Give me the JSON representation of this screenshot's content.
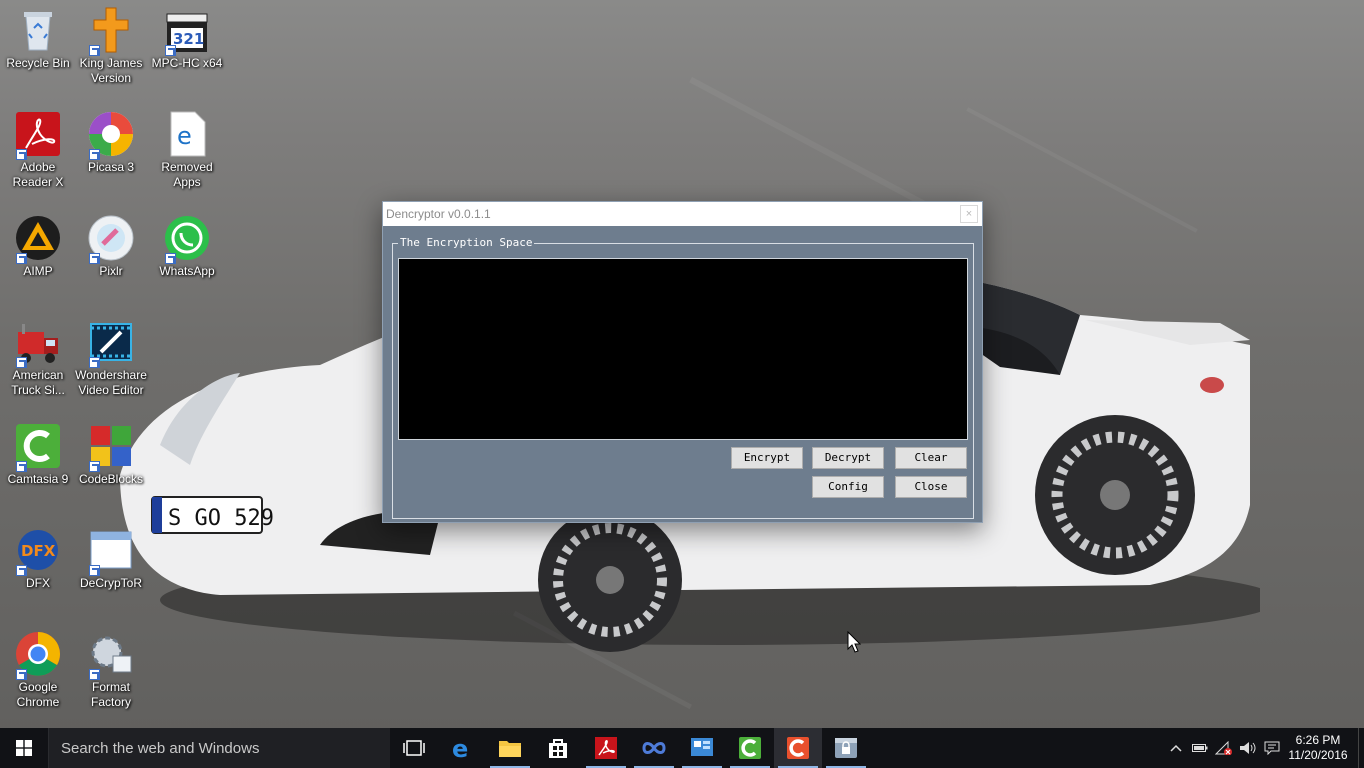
{
  "desktop": {
    "icons": [
      {
        "label": "Recycle Bin",
        "icon": "recycle-bin-icon"
      },
      {
        "label": "King James Version",
        "icon": "cross-icon"
      },
      {
        "label": "MPC-HC x64",
        "icon": "mpc-clapper-icon"
      },
      {
        "label": "Adobe Reader X",
        "icon": "adobe-reader-icon"
      },
      {
        "label": "Picasa 3",
        "icon": "picasa-icon"
      },
      {
        "label": "Removed Apps",
        "icon": "edge-document-icon"
      },
      {
        "label": "AIMP",
        "icon": "aimp-icon"
      },
      {
        "label": "Pixlr",
        "icon": "pixlr-icon"
      },
      {
        "label": "WhatsApp",
        "icon": "whatsapp-icon"
      },
      {
        "label": "American Truck Si...",
        "icon": "truck-icon"
      },
      {
        "label": "Wondershare Video Editor",
        "icon": "video-editor-icon"
      },
      {
        "label": "Camtasia 9",
        "icon": "camtasia-icon"
      },
      {
        "label": "CodeBlocks",
        "icon": "codeblocks-icon"
      },
      {
        "label": "DFX",
        "icon": "dfx-icon"
      },
      {
        "label": "DeCrypToR",
        "icon": "window-app-icon"
      },
      {
        "label": "Google Chrome",
        "icon": "chrome-icon"
      },
      {
        "label": "Format Factory",
        "icon": "format-factory-icon"
      }
    ]
  },
  "wallpaper": {
    "license_plate": "S GO 529"
  },
  "window": {
    "title": "Dencryptor v0.0.1.1",
    "close_glyph": "×",
    "group_label": "The Encryption Space",
    "textarea_value": "",
    "buttons": {
      "encrypt": "Encrypt",
      "decrypt": "Decrypt",
      "clear": "Clear",
      "config": "Config",
      "close": "Close"
    }
  },
  "taskbar": {
    "search_placeholder": "Search the web and Windows",
    "pinned": [
      "task-view-icon",
      "edge-icon",
      "file-explorer-icon",
      "store-icon",
      "adobe-reader-icon",
      "infinity-app-icon",
      "control-panel-icon",
      "camtasia-icon",
      "camtasia-recorder-icon",
      "dencryptor-icon"
    ],
    "clock_time": "6:26 PM",
    "clock_date": "11/20/2016"
  },
  "colors": {
    "window_body": "#6e7d8e",
    "textarea_bg": "#000000",
    "taskbar_bg": "#111216",
    "button_face": "#e1e1e1"
  }
}
